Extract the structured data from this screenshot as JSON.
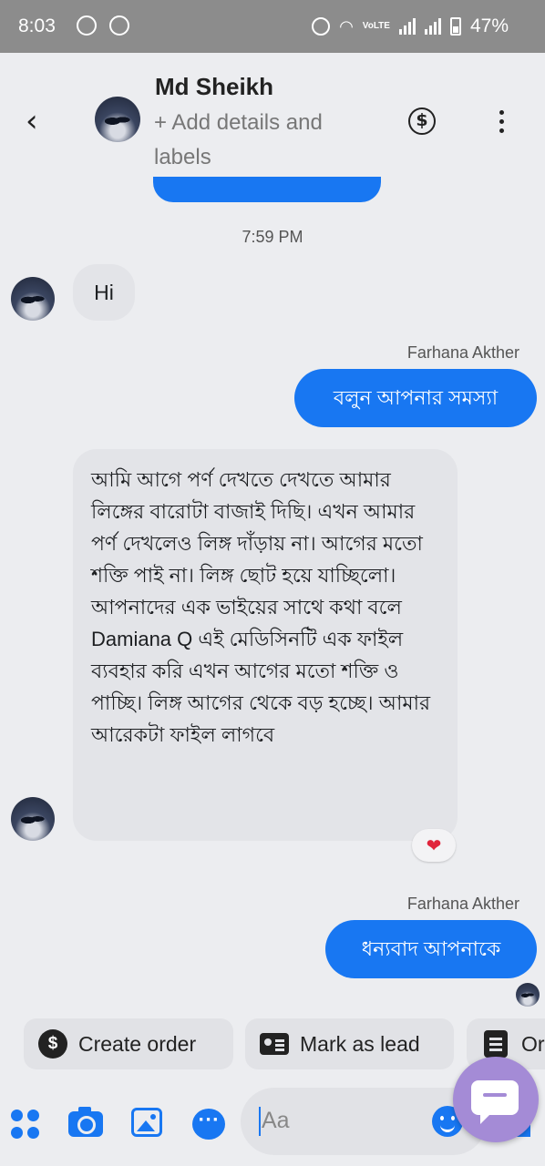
{
  "status_bar": {
    "time": "8:03",
    "network": "VoLTE",
    "battery": "47%"
  },
  "header": {
    "contact_name": "Md Sheikh",
    "details_label": "+ Add details and labels",
    "back_icon": "chevron-left-icon",
    "payment_icon": "dollar-icon",
    "menu_icon": "more-vertical-icon"
  },
  "conversation": {
    "timestamp": "7:59 PM",
    "messages": [
      {
        "direction": "incoming",
        "text": "Hi"
      },
      {
        "direction": "outgoing",
        "sender": "Farhana Akther",
        "text": "বলুন আপনার সমস্যা"
      },
      {
        "direction": "incoming",
        "text": "আমি আগে পর্ণ দেখতে দেখতে আমার লিঙ্গের বারোটা বাজাই দিছি। এখন আমার পর্ণ দেখলেও লিঙ্গ দাঁড়ায় না। আগের মতো শক্তি পাই না। লিঙ্গ ছোট হয়ে যাচ্ছিলো। আপনাদের এক ভাইয়ের সাথে কথা বলে Damiana Q এই মেডিসিনটি এক ফাইল ব্যবহার করি এখন আগের মতো শক্তি ও পাচ্ছি। লিঙ্গ আগের থেকে  বড় হচ্ছে। আমার আরেকটা ফাইল লাগবে",
        "reaction": "❤"
      },
      {
        "direction": "outgoing",
        "sender": "Farhana Akther",
        "text": "ধন্যবাদ আপনাকে"
      }
    ]
  },
  "quick_actions": [
    {
      "label": "Create order",
      "icon": "dollar-circle-icon"
    },
    {
      "label": "Mark as lead",
      "icon": "contact-card-icon"
    },
    {
      "label": "Or",
      "icon": "note-icon"
    }
  ],
  "composer": {
    "placeholder": "Aa",
    "icons": [
      "apps-icon",
      "camera-icon",
      "image-icon",
      "chat-bubble-icon",
      "emoji-icon",
      "send-icon"
    ]
  },
  "colors": {
    "accent": "#1877f2",
    "incoming_bubble": "#e3e4e8",
    "background": "#ecedf0",
    "fab": "#a48bd6",
    "reaction": "#e0243b"
  }
}
